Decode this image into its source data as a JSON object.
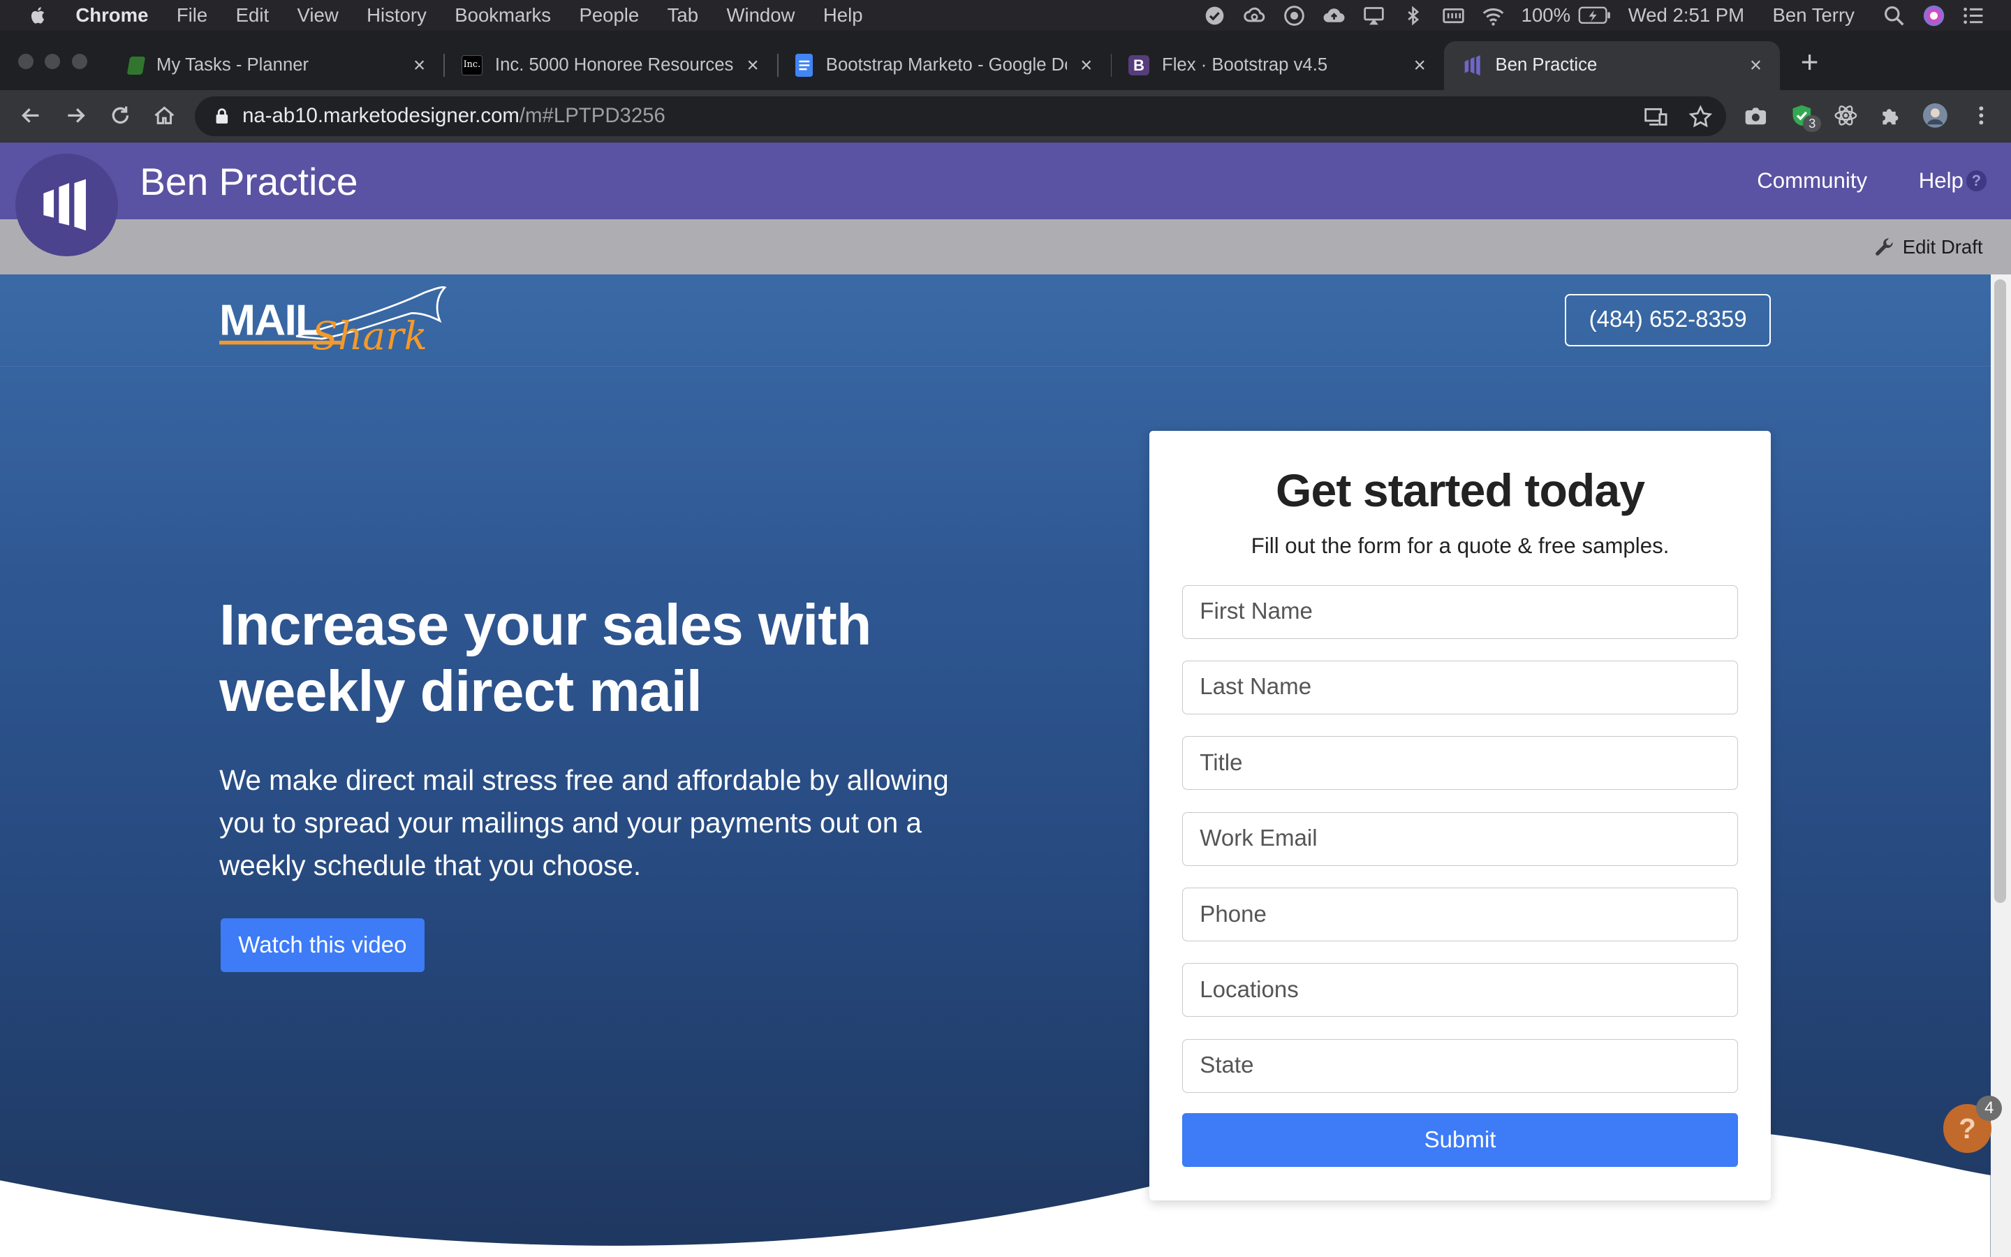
{
  "menubar": {
    "app": "Chrome",
    "items": [
      "File",
      "Edit",
      "View",
      "History",
      "Bookmarks",
      "People",
      "Tab",
      "Window",
      "Help"
    ],
    "battery": "100%",
    "clock": "Wed 2:51 PM",
    "user": "Ben Terry"
  },
  "tabs": [
    {
      "title": "My Tasks - Planner",
      "favicon_color": "#31752f"
    },
    {
      "title": "Inc. 5000 Honoree Resources",
      "favicon_color": "#000000"
    },
    {
      "title": "Bootstrap Marketo - Google Docs",
      "favicon_color": "#4285f4"
    },
    {
      "title": "Flex · Bootstrap v4.5",
      "favicon_color": "#563d7c"
    },
    {
      "title": "Ben Practice",
      "favicon_color": "#5a52a2"
    }
  ],
  "omnibox": {
    "host": "na-ab10.marketodesigner.com",
    "path": "/m#LPTPD3256"
  },
  "extensions": {
    "badge": "3"
  },
  "marketo": {
    "title": "Ben Practice",
    "nav": [
      "Community",
      "Help"
    ],
    "edit_draft": "Edit Draft",
    "brand_color": "#5a52a2"
  },
  "landing": {
    "logo_text": "MAIL",
    "logo_script": "Shark",
    "phone": "(484) 652-8359",
    "headline": "Increase your sales with weekly direct mail",
    "body": "We make direct mail stress free and affordable by allowing you to spread your mailings and your payments out on a weekly schedule that you choose.",
    "video_button": "Watch this video",
    "button_color": "#3d7bf7"
  },
  "form": {
    "title": "Get started today",
    "subtitle": "Fill out the form for a quote & free samples.",
    "fields": [
      {
        "placeholder": "First Name",
        "value": ""
      },
      {
        "placeholder": "Last Name",
        "value": ""
      },
      {
        "placeholder": "Title",
        "value": ""
      },
      {
        "placeholder": "Work Email",
        "value": ""
      },
      {
        "placeholder": "Phone",
        "value": ""
      },
      {
        "placeholder": "Locations",
        "value": ""
      },
      {
        "placeholder": "State",
        "value": ""
      }
    ],
    "submit": "Submit"
  },
  "help_widget": {
    "icon": "question-icon",
    "glyph": "?",
    "badge": "4"
  }
}
